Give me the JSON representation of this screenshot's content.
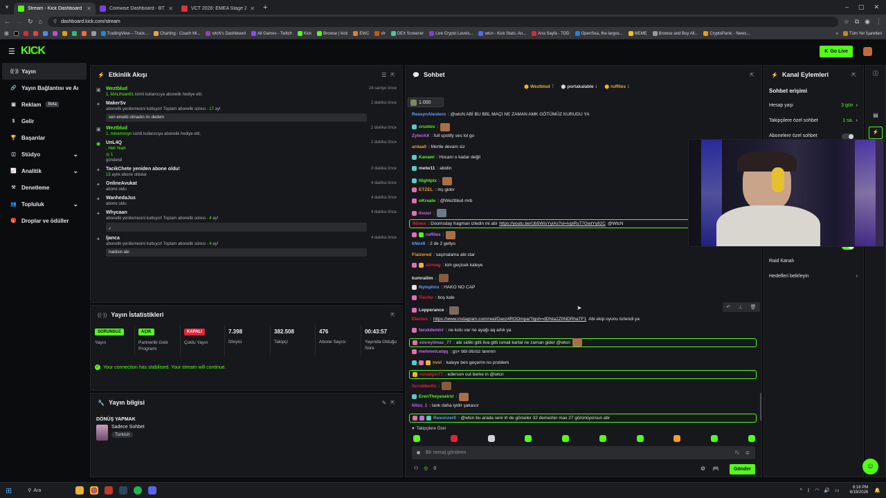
{
  "browser": {
    "tabs": [
      {
        "title": "Stream - Kick Dashboard",
        "favicon_color": "#53fc18",
        "active": true
      },
      {
        "title": "Coinwise Dashboard - BTC Cryp",
        "favicon_color": "#7b3fe4",
        "active": false
      },
      {
        "title": "VCT 2026: EMEA Stage 2: Brack",
        "favicon_color": "#d6353f",
        "active": false
      }
    ],
    "url": "dashboard.kick.com/stream",
    "bookmarks": [
      "TradingView – Track...",
      "Charting - Coach Mi...",
      "wtcN's Dashboard",
      "All Games - Twitch",
      "Kick",
      "Browse | kick",
      "EWC",
      "vlr",
      "DEX Screener",
      "Live Crypto Levels...",
      "wtcn - Kick Stats, An...",
      "Ana Sayfa - TOD",
      "OpenSea, the larges...",
      "MEME",
      "Browse and Buy All...",
      "CryptoPanic - News..."
    ],
    "bookmarks_right": "Tüm Yer İşaretleri"
  },
  "app": {
    "logo": "KICK",
    "go_live": "Go Live"
  },
  "sidebar": {
    "items": [
      {
        "label": "Yayın",
        "icon": "broadcast-icon",
        "glyph": "((·))",
        "active": true
      },
      {
        "label": "Yayın Bağlantısı ve Anahtarı",
        "icon": "link-icon",
        "glyph": "🔗"
      },
      {
        "label": "Reklam",
        "icon": "ad-icon",
        "glyph": "▣",
        "badge": "Beta"
      },
      {
        "label": "Gelir",
        "icon": "dollar-icon",
        "glyph": "$"
      },
      {
        "label": "Başarılar",
        "icon": "trophy-icon",
        "glyph": "🏆"
      },
      {
        "label": "Stüdyo",
        "icon": "studio-icon",
        "glyph": "◫",
        "chevron": "⌄"
      },
      {
        "label": "Analitik",
        "icon": "analytics-icon",
        "glyph": "📈",
        "chevron": "⌄"
      },
      {
        "label": "Denetleme",
        "icon": "hammer-icon",
        "glyph": "⚒"
      },
      {
        "label": "Topluluk",
        "icon": "community-icon",
        "glyph": "👥",
        "chevron": "⌄"
      },
      {
        "label": "Droplar ve ödüller",
        "icon": "gift-icon",
        "glyph": "🎁"
      }
    ]
  },
  "activity": {
    "title": "Etkinlik Akışı",
    "items": [
      {
        "name": "Weztblud",
        "name_green": true,
        "sub_bold": "1, MALihsan61",
        "sub": " isimli kullanıcıya abonelik hediye etti.",
        "time": "24 saniye önce",
        "icon": "gift-icon",
        "glyph": "▣"
      },
      {
        "name": "MakerSv",
        "sub": "abonelik yenilemesini kutluyor! Toplam abonelik süresi - ",
        "sub_bold": "17",
        "sub_tail": " ay!",
        "msg": "sen emekli olmadın mı dedem",
        "time": "2 dakika önce",
        "icon": "star-icon",
        "glyph": "✦"
      },
      {
        "name": "Weztblud",
        "name_green": true,
        "sub_bold": "1, minemosyn",
        "sub": " isimli kullanıcıya abonelik hediye etti.",
        "time": "2 dakika önce",
        "icon": "gift-icon",
        "glyph": "▣"
      },
      {
        "name": "UnL4Q",
        "line2": ", Heli Yeah",
        "line3": "1",
        "line4": "gönderdi",
        "time": "2 dakika önce",
        "icon": "kicks-icon",
        "glyph": "◉"
      },
      {
        "name": "TacikChete yeniden abone oldu!",
        "sub_bold": "13",
        "sub": " aylık abone oldular",
        "time": "3 dakika önce",
        "icon": "resub-icon",
        "glyph": "✦"
      },
      {
        "name": "OnlineAvukat",
        "sub": "abone oldu",
        "time": "4 dakika önce",
        "icon": "star-icon",
        "glyph": "✦"
      },
      {
        "name": "WanhedaJus",
        "sub": "abone oldu",
        "time": "4 dakika önce",
        "icon": "star-icon",
        "glyph": "✦"
      },
      {
        "name": "Whycaan",
        "sub": "abonelik yenilemesini kutluyor! Toplam abonelik süresi - ",
        "sub_bold": "4",
        "sub_tail": " ay!",
        "msg": "ﺯ",
        "time": "4 dakika önce",
        "icon": "star-icon",
        "glyph": "✦"
      },
      {
        "name": "ljanca",
        "sub": "abonelik yenilemesini kutluyor! Toplam abonelik süresi - ",
        "sub_bold": "4",
        "sub_tail": " ay!",
        "msg": "haklisin abi",
        "time": "4 dakika önce",
        "icon": "star-icon",
        "glyph": "✦"
      }
    ]
  },
  "stats": {
    "title": "Yayın İstatistikleri",
    "cols": [
      {
        "badge": "SORUNSUZ",
        "badge_color": "#53fc18",
        "label": "Yayın"
      },
      {
        "badge": "AÇIK",
        "badge_color": "#53fc18",
        "label": "Partnerlik Gelir Programı"
      },
      {
        "badge": "KAPALI",
        "badge_color": "#e0253a",
        "label": "Çoklu Yayın"
      },
      {
        "value": "7.398",
        "label": "İzleyici"
      },
      {
        "value": "382.508",
        "label": "Takipçi"
      },
      {
        "value": "476",
        "label": "Abone Sayısı"
      },
      {
        "value": "00:43:57",
        "label": "Yayında Olduğu Süre"
      }
    ],
    "notice": "Your connection has stabilised. Your stream will continue."
  },
  "stream_info": {
    "title": "Yayın bilgisi",
    "stream_title": "DÖNÜŞ YAPMAK",
    "category": "Sadece Sohbet",
    "tag": "Turkish"
  },
  "chat": {
    "title": "Sohbet",
    "gifters": [
      {
        "name": "Weztblud",
        "count": "7",
        "color": "#f0b429"
      },
      {
        "name": "portakalable",
        "count": "1",
        "color": "#d5d8dc"
      },
      {
        "name": "ruffiles",
        "count": "1",
        "color": "#f0b429"
      }
    ],
    "pinned_amount": "1.000",
    "messages": [
      {
        "user": "ReasynAlestero",
        "color": "#5fa0ff",
        "text": ": @wtcN ABİ BU BBL MAÇI NE ZAMAN AMK GÖTÜMÜZ KURUDU YA",
        "badges": []
      },
      {
        "user": "crustov",
        "color": "#53fc18",
        "text": ":",
        "badges": [
          "#5bc8c8"
        ],
        "emote": true
      },
      {
        "user": "ZytechX",
        "color": "#c56cf0",
        "text": ": full spotify ses lol go",
        "badges": []
      },
      {
        "user": "ardaa0",
        "color": "#f0a030",
        "text": ": Mertle devam siz",
        "badges": []
      },
      {
        "user": "Kanawi",
        "color": "#53fc18",
        "text": ": Hocam o kadar değil",
        "badges": [
          "#5bc8c8"
        ]
      },
      {
        "user": "metw11",
        "color": "#e2e5e8",
        "text": ": abidin",
        "badges": [
          "#5bc8c8"
        ]
      },
      {
        "user": "Nightpix",
        "color": "#53fc18",
        "text": ":",
        "badges": [
          "#5bc8c8"
        ],
        "emote": true
      },
      {
        "user": "ETZEL",
        "color": "#f0a030",
        "text": ": inş gider",
        "badges": [
          "#e070b0"
        ]
      },
      {
        "user": "oKreate",
        "color": "#53fc18",
        "text": ": @Weztblud mrb",
        "badges": [
          "#e070b0"
        ]
      },
      {
        "user": "itsuur",
        "color": "#c56cf0",
        "text": ":",
        "badges": [
          "#e070b0"
        ],
        "emote": true
      },
      {
        "user": "iNinex",
        "color": "#e0253a",
        "text": ": Doomsday fragman izledin mi abi ",
        "link": "https://youtu.be/Ub5WisYyiAs?si=ivpiRs77GwtYy82C",
        "tail": " @WtcN",
        "highlight": true
      },
      {
        "user": "ruffiles",
        "color": "#c56cf0",
        "text": ":",
        "badges": [
          "#e070b0",
          "#53fc18"
        ],
        "emote": true
      },
      {
        "user": "kNox6",
        "color": "#5fa0ff",
        "text": ": 2 de 2 geliyo",
        "badges": []
      },
      {
        "user": "Flaizered",
        "color": "#f0a030",
        "text": ": saçmalama abi star",
        "badges": []
      },
      {
        "user": "sirmag",
        "color": "#e0253a",
        "text": ": kim geçicek kaleye",
        "badges": [
          "#e070b0",
          "#f0b429"
        ]
      },
      {
        "user": "kumraliim",
        "color": "#e2e5e8",
        "text": ":",
        "badges": [],
        "emote": true
      },
      {
        "user": "Nymphnx",
        "color": "#5fa0ff",
        "text": ": HAKO NO CAP",
        "badges": [
          "#e2e5e8"
        ]
      },
      {
        "user": "Tiecho",
        "color": "#e0253a",
        "text": ": boş kale",
        "badges": [
          "#e070b0"
        ]
      },
      {
        "user": "Lepperance",
        "color": "#e2e5e8",
        "text": ":",
        "badges": [
          "#e070b0"
        ],
        "emote": true
      },
      {
        "user": "Electus",
        "color": "#e0253a",
        "text": ": ",
        "link": "https://www.instagram.com/reel/Daxz4ROOmpa/?igsh=dDNia2Z0NDRhaTF1",
        "tail": " Abi ekip oyunu özlendi ya",
        "badges": []
      },
      {
        "user": "farukdemirr",
        "color": "#c56cf0",
        "text": ": ne kolu var ne ayağı aq artık ya",
        "badges": [
          "#e070b0"
        ]
      },
      {
        "user": "emreyilmaz_77",
        "color": "#c56cf0",
        "text": ": abi sidiki gitti liva gitti ismail kartal ne zaman gider @wtcn",
        "badges": [
          "#e070b0"
        ],
        "highlight": true,
        "emote": true
      },
      {
        "user": "mehmetcatqq",
        "color": "#c56cf0",
        "text": ": gs+ bbl ölürüz lannnn",
        "badges": [
          "#e070b0"
        ]
      },
      {
        "user": "nvvi",
        "color": "#f0a030",
        "text": ": kaleye ben geçerim no problem",
        "badges": [
          "#5bc8c8",
          "#e070b0",
          "#f0b429"
        ]
      },
      {
        "user": "novalgin77",
        "color": "#e0253a",
        "text": ": ederson out berke in @wtcn",
        "badges": [
          "#f0b429"
        ],
        "highlight": true
      },
      {
        "user": "Scrubbedix",
        "color": "#e0253a",
        "text": ":",
        "badges": [],
        "emote": true
      },
      {
        "user": "ErenTheyeseirst",
        "color": "#53fc18",
        "text": ":",
        "badges": [
          "#5bc8c8"
        ],
        "emote": true
      },
      {
        "user": "kitsu_1",
        "color": "#c56cf0",
        "text": ": tank daha iyidir şakasız",
        "badges": []
      },
      {
        "user": "Rexonzer0",
        "color": "#5fa0ff",
        "text": ": @wtcn bu arada seni irl de görseler 32 demezler max 27 görünüyorsun abi",
        "badges": [
          "#e070b0",
          "#c56cf0",
          "#5bc8c8"
        ],
        "highlight": true
      }
    ],
    "followers_only": "Takipçilere Özel",
    "input_placeholder": "Bir mesaj gönderin",
    "kicks_count": "0",
    "send": "Gönder"
  },
  "channel_actions": {
    "title": "Kanal Eylemleri",
    "section": "Sohbet erişimi",
    "rows": [
      {
        "label": "Hesap yaşı",
        "value": "3 gün"
      },
      {
        "label": "Takipçilere özel sohbet",
        "value": "1 sa."
      },
      {
        "label": "Abonelere özel sohbet",
        "value": ""
      }
    ],
    "raid": "Raid Kanalı",
    "goals": "Hedefleri belirleyin"
  },
  "taskbar": {
    "search": "Ara",
    "time": "8:18 PM",
    "date": "6/19/2026"
  }
}
